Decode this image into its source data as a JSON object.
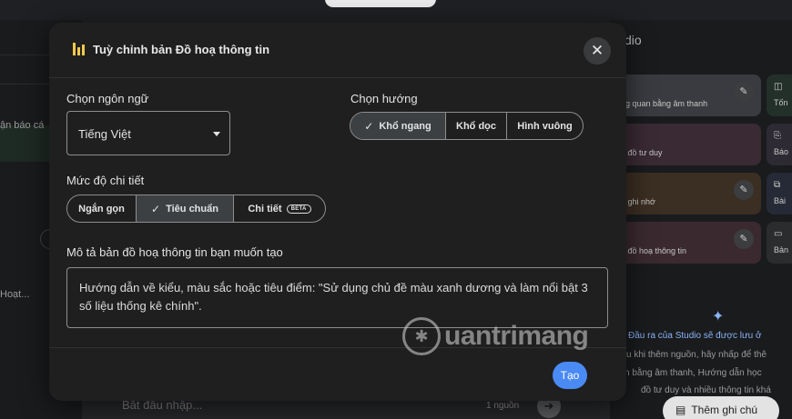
{
  "background": {
    "left_panel": {
      "item1": "ận báo cá",
      "item2": "Hoạt..."
    },
    "right_panel": {
      "title": "dio",
      "cards": [
        {
          "label": "ng quan bằng âm thanh",
          "color": "#3a3b40"
        },
        {
          "label": "n đồ tư duy",
          "color": "#3a2a33"
        },
        {
          "label": "ề ghi nhớ",
          "color": "#3b2e22"
        },
        {
          "label": "n đồ hoạ thông tin",
          "color": "#3a2a30"
        }
      ],
      "minis": [
        {
          "icon": "◫",
          "label": "Tốn",
          "color": "#23302a"
        },
        {
          "icon": "⎘",
          "label": "Báo",
          "color": "#2e2a33"
        },
        {
          "icon": "⧉",
          "label": "Bài",
          "color": "#262a36"
        },
        {
          "icon": "▭",
          "label": "Bản",
          "color": "#2b2c2e"
        }
      ],
      "info_line1": "Đầu ra của Studio sẽ được lưu ở",
      "info_line2": "u khi thêm nguồn, hãy nhấp để thê",
      "info_line3": "n bằng âm thanh, Hướng dẫn học",
      "info_line4": "đồ tư duy và nhiều thông tin khá",
      "add_note_label": "Thêm ghi chú"
    },
    "chat_input": {
      "placeholder": "Bắt đầu nhập...",
      "source_count": "1 nguồn"
    }
  },
  "modal": {
    "title": "Tuỳ chỉnh bản Đồ hoạ thông tin",
    "language": {
      "label": "Chọn ngôn ngữ",
      "value": "Tiếng Việt"
    },
    "orientation": {
      "label": "Chọn hướng",
      "options": [
        "Khổ ngang",
        "Khổ dọc",
        "Hình vuông"
      ],
      "selected": "Khổ ngang"
    },
    "detail": {
      "label": "Mức độ chi tiết",
      "options": [
        "Ngắn gọn",
        "Tiêu chuẩn",
        "Chi tiết"
      ],
      "selected": "Tiêu chuẩn",
      "beta_badge": "BETA"
    },
    "description": {
      "label": "Mô tả bản đồ hoạ thông tin bạn muốn tạo",
      "value": "Hướng dẫn về kiểu, màu sắc hoặc tiêu điểm: \"Sử dụng chủ đề màu xanh dương và làm nổi bật 3 số liệu thống kê chính\"."
    },
    "create_label": "Tạo"
  },
  "watermark": "uantrimang",
  "colors": {
    "accent": "#4a8af4",
    "icon_yellow": "#f2c94c",
    "link_blue": "#8ab4f8"
  }
}
